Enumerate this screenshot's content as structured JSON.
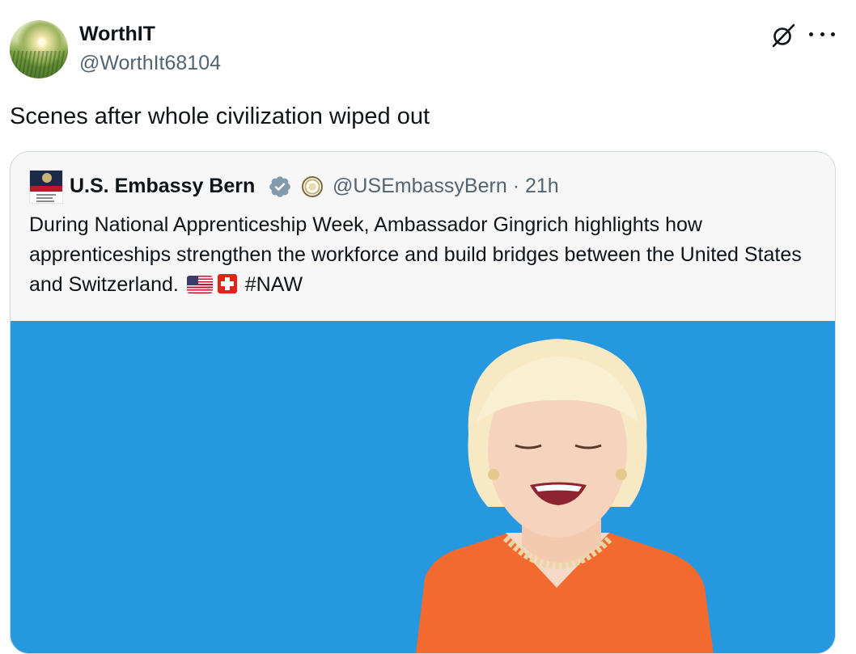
{
  "tweet": {
    "display_name": "WorthIT",
    "handle": "@WorthIt68104",
    "text": "Scenes after whole civilization wiped out"
  },
  "quoted_tweet": {
    "display_name": "U.S. Embassy Bern",
    "handle": "@USEmbassyBern",
    "separator": "·",
    "timestamp": "21h",
    "text_main": "During National Apprenticeship Week, Ambassador Gingrich highlights how apprenticeships strengthen the workforce and build bridges between the United States and Switzerland.",
    "hashtag": "#NAW",
    "icons": [
      "embassy-logo",
      "verified-badge-icon",
      "state-department-seal-icon",
      "us-flag-emoji",
      "swiss-flag-emoji"
    ]
  },
  "icons": {
    "grok": "grok-icon",
    "more": "more-options-icon"
  },
  "colors": {
    "media_background": "#2698df",
    "verified_badge": "#829aab",
    "handle_gray": "#536471"
  }
}
